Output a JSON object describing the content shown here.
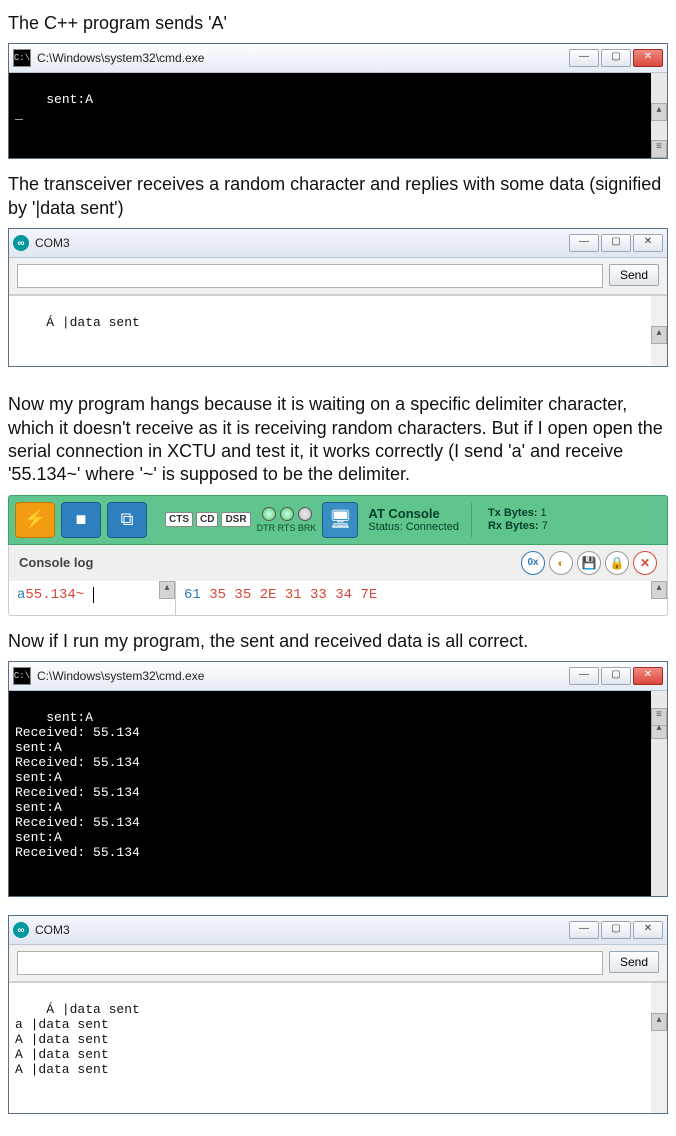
{
  "heading1": "The C++ program sends 'A'",
  "cmd1": {
    "title": "C:\\Windows\\system32\\cmd.exe",
    "body": "sent:A\n_"
  },
  "heading2": "The transceiver receives a random character and replies with some data (signified by '|data sent')",
  "serial1": {
    "title": "COM3",
    "send_label": "Send",
    "body": "Á |data sent"
  },
  "heading3": "Now my program hangs because it is waiting on a specific delimiter character, which it doesn't receive as it is receiving random characters. But if I open open the serial connection in XCTU and test it, it works correctly (I send 'a' and receive '55.134~' where '~' is supposed to be the delimiter.",
  "xctu": {
    "indicators": {
      "cts": "CTS",
      "cd": "CD",
      "dsr": "DSR"
    },
    "leds_label": "DTR RTS BRK",
    "status_title": "AT Console",
    "status_label": "Status:",
    "status_value": "Connected",
    "tx_label": "Tx Bytes:",
    "tx_value": "1",
    "rx_label": "Rx Bytes:",
    "rx_value": "7",
    "log_label": "Console log",
    "hex_btn": "0x",
    "sent_char": "a",
    "recv_text": "55.134~",
    "hex_line": "61 35 35 2E 31 33 34 7E"
  },
  "heading4": "Now if I run my program, the sent and received data is all correct.",
  "cmd2": {
    "title": "C:\\Windows\\system32\\cmd.exe",
    "body": "sent:A\nReceived: 55.134\nsent:A\nReceived: 55.134\nsent:A\nReceived: 55.134\nsent:A\nReceived: 55.134\nsent:A\nReceived: 55.134"
  },
  "serial2": {
    "title": "COM3",
    "send_label": "Send",
    "body": "Á |data sent\na |data sent\nA |data sent\nA |data sent\nA |data sent"
  }
}
